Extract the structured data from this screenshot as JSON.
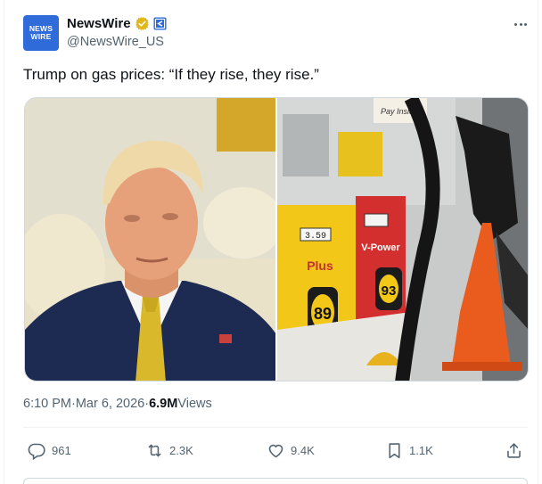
{
  "author": {
    "avatar_line1": "NEWS",
    "avatar_line2": "WIRE",
    "display_name": "NewsWire",
    "handle": "@NewsWire_US",
    "verified_icon": "verified-badge-icon",
    "affiliation_icon": "affiliate-badge-icon"
  },
  "tweet": {
    "text": "Trump on gas prices: “If they rise, they rise.”"
  },
  "media": {
    "photo_left": "portrait-photo",
    "photo_right": "gas-pump-photo",
    "pump_price": "3.59",
    "grade_plus_label": "Plus",
    "grade_plus_number": "89",
    "grade_vpower_label": "V-Power",
    "grade_vpower_number": "93",
    "handwritten_note": "Pay Inside"
  },
  "meta": {
    "time": "6:10 PM",
    "sep1": " · ",
    "date": "Mar 6, 2026",
    "sep2": " · ",
    "views_count": "6.9M",
    "views_label": " Views"
  },
  "actions": {
    "replies": "961",
    "reposts": "2.3K",
    "likes": "9.4K",
    "bookmarks": "1.1K"
  },
  "colors": {
    "text_primary": "#0f1419",
    "text_secondary": "#536471",
    "verified_gold": "#e2b719",
    "avatar_blue": "#2f6bd9"
  }
}
